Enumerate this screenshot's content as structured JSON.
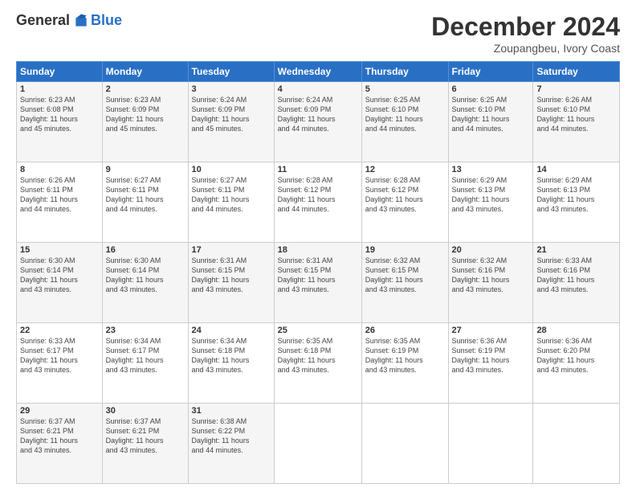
{
  "logo": {
    "general": "General",
    "blue": "Blue"
  },
  "header": {
    "title": "December 2024",
    "subtitle": "Zoupangbeu, Ivory Coast"
  },
  "days_of_week": [
    "Sunday",
    "Monday",
    "Tuesday",
    "Wednesday",
    "Thursday",
    "Friday",
    "Saturday"
  ],
  "weeks": [
    [
      {
        "day": "1",
        "sunrise": "6:23 AM",
        "sunset": "6:08 PM",
        "daylight": "11 hours and 45 minutes."
      },
      {
        "day": "2",
        "sunrise": "6:23 AM",
        "sunset": "6:09 PM",
        "daylight": "11 hours and 45 minutes."
      },
      {
        "day": "3",
        "sunrise": "6:24 AM",
        "sunset": "6:09 PM",
        "daylight": "11 hours and 45 minutes."
      },
      {
        "day": "4",
        "sunrise": "6:24 AM",
        "sunset": "6:09 PM",
        "daylight": "11 hours and 44 minutes."
      },
      {
        "day": "5",
        "sunrise": "6:25 AM",
        "sunset": "6:10 PM",
        "daylight": "11 hours and 44 minutes."
      },
      {
        "day": "6",
        "sunrise": "6:25 AM",
        "sunset": "6:10 PM",
        "daylight": "11 hours and 44 minutes."
      },
      {
        "day": "7",
        "sunrise": "6:26 AM",
        "sunset": "6:10 PM",
        "daylight": "11 hours and 44 minutes."
      }
    ],
    [
      {
        "day": "8",
        "sunrise": "6:26 AM",
        "sunset": "6:11 PM",
        "daylight": "11 hours and 44 minutes."
      },
      {
        "day": "9",
        "sunrise": "6:27 AM",
        "sunset": "6:11 PM",
        "daylight": "11 hours and 44 minutes."
      },
      {
        "day": "10",
        "sunrise": "6:27 AM",
        "sunset": "6:11 PM",
        "daylight": "11 hours and 44 minutes."
      },
      {
        "day": "11",
        "sunrise": "6:28 AM",
        "sunset": "6:12 PM",
        "daylight": "11 hours and 44 minutes."
      },
      {
        "day": "12",
        "sunrise": "6:28 AM",
        "sunset": "6:12 PM",
        "daylight": "11 hours and 43 minutes."
      },
      {
        "day": "13",
        "sunrise": "6:29 AM",
        "sunset": "6:13 PM",
        "daylight": "11 hours and 43 minutes."
      },
      {
        "day": "14",
        "sunrise": "6:29 AM",
        "sunset": "6:13 PM",
        "daylight": "11 hours and 43 minutes."
      }
    ],
    [
      {
        "day": "15",
        "sunrise": "6:30 AM",
        "sunset": "6:14 PM",
        "daylight": "11 hours and 43 minutes."
      },
      {
        "day": "16",
        "sunrise": "6:30 AM",
        "sunset": "6:14 PM",
        "daylight": "11 hours and 43 minutes."
      },
      {
        "day": "17",
        "sunrise": "6:31 AM",
        "sunset": "6:15 PM",
        "daylight": "11 hours and 43 minutes."
      },
      {
        "day": "18",
        "sunrise": "6:31 AM",
        "sunset": "6:15 PM",
        "daylight": "11 hours and 43 minutes."
      },
      {
        "day": "19",
        "sunrise": "6:32 AM",
        "sunset": "6:15 PM",
        "daylight": "11 hours and 43 minutes."
      },
      {
        "day": "20",
        "sunrise": "6:32 AM",
        "sunset": "6:16 PM",
        "daylight": "11 hours and 43 minutes."
      },
      {
        "day": "21",
        "sunrise": "6:33 AM",
        "sunset": "6:16 PM",
        "daylight": "11 hours and 43 minutes."
      }
    ],
    [
      {
        "day": "22",
        "sunrise": "6:33 AM",
        "sunset": "6:17 PM",
        "daylight": "11 hours and 43 minutes."
      },
      {
        "day": "23",
        "sunrise": "6:34 AM",
        "sunset": "6:17 PM",
        "daylight": "11 hours and 43 minutes."
      },
      {
        "day": "24",
        "sunrise": "6:34 AM",
        "sunset": "6:18 PM",
        "daylight": "11 hours and 43 minutes."
      },
      {
        "day": "25",
        "sunrise": "6:35 AM",
        "sunset": "6:18 PM",
        "daylight": "11 hours and 43 minutes."
      },
      {
        "day": "26",
        "sunrise": "6:35 AM",
        "sunset": "6:19 PM",
        "daylight": "11 hours and 43 minutes."
      },
      {
        "day": "27",
        "sunrise": "6:36 AM",
        "sunset": "6:19 PM",
        "daylight": "11 hours and 43 minutes."
      },
      {
        "day": "28",
        "sunrise": "6:36 AM",
        "sunset": "6:20 PM",
        "daylight": "11 hours and 43 minutes."
      }
    ],
    [
      {
        "day": "29",
        "sunrise": "6:37 AM",
        "sunset": "6:21 PM",
        "daylight": "11 hours and 43 minutes."
      },
      {
        "day": "30",
        "sunrise": "6:37 AM",
        "sunset": "6:21 PM",
        "daylight": "11 hours and 43 minutes."
      },
      {
        "day": "31",
        "sunrise": "6:38 AM",
        "sunset": "6:22 PM",
        "daylight": "11 hours and 44 minutes."
      },
      null,
      null,
      null,
      null
    ]
  ]
}
